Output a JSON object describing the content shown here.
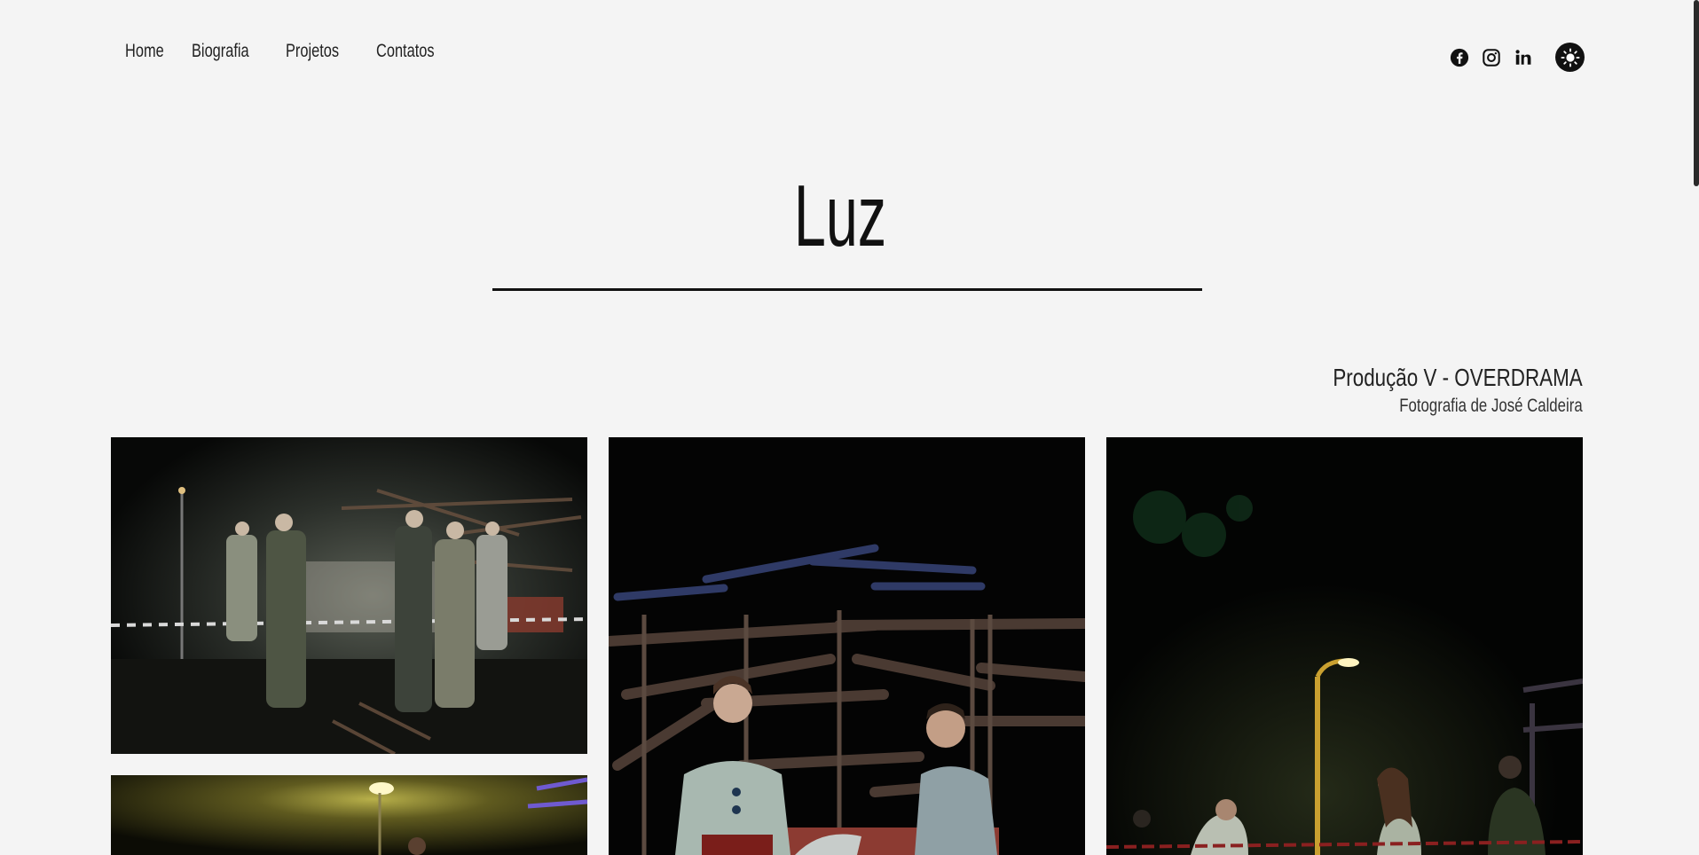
{
  "nav": {
    "home": "Home",
    "biografia": "Biografia",
    "projetos": "Projetos",
    "contatos": "Contatos"
  },
  "social": {
    "icons": [
      "facebook-icon",
      "instagram-icon",
      "linkedin-icon"
    ],
    "theme_icon": "sun-icon"
  },
  "page": {
    "title": "Luz"
  },
  "credits": {
    "production": "Produção V - OVERDRAMA",
    "photography": "Fotografia de José Caldeira"
  },
  "colors": {
    "background": "#f4f4f4",
    "text": "#111111"
  }
}
